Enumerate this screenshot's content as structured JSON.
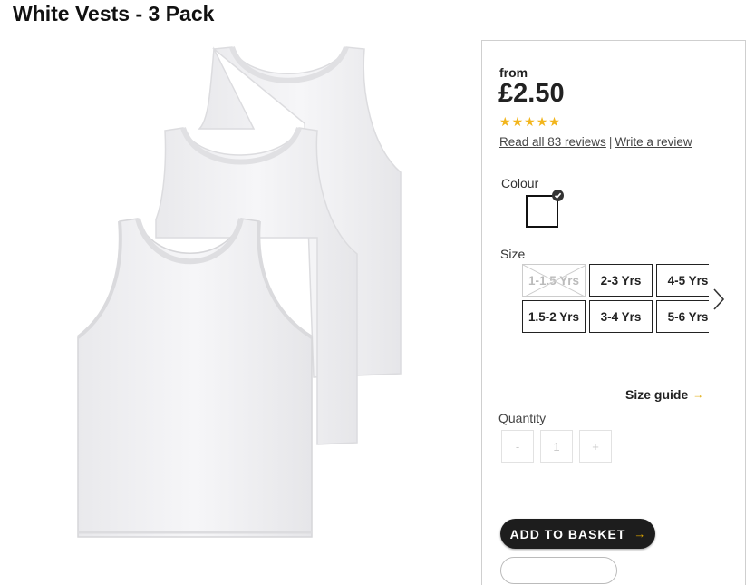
{
  "product": {
    "title": "White Vests - 3 Pack"
  },
  "price": {
    "prefix": "from",
    "amount": "£2.50"
  },
  "rating": {
    "stars": 5,
    "star_color": "#f2b51c"
  },
  "reviews": {
    "read_label": "Read all 83 reviews",
    "separator": "|",
    "write_label": "Write a review"
  },
  "colour": {
    "label": "Colour",
    "selected_color": "#ffffff"
  },
  "size": {
    "label": "Size",
    "options": [
      {
        "label": "1-1.5 Yrs",
        "available": false
      },
      {
        "label": "2-3 Yrs",
        "available": true
      },
      {
        "label": "4-5 Yrs",
        "available": true
      },
      {
        "label": "1.5-2 Yrs",
        "available": true
      },
      {
        "label": "3-4 Yrs",
        "available": true
      },
      {
        "label": "5-6 Yrs",
        "available": true
      }
    ],
    "guide_label": "Size guide"
  },
  "quantity": {
    "label": "Quantity",
    "minus": "-",
    "value": "1",
    "plus": "+"
  },
  "actions": {
    "add_to_basket": "ADD TO BASKET",
    "arrow": "→"
  }
}
